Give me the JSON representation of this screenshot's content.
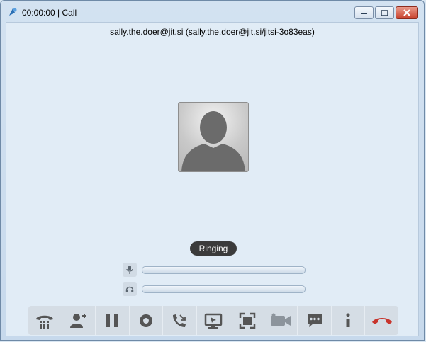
{
  "window": {
    "title": "00:00:00 | Call",
    "icon": "jitsi-logo-icon"
  },
  "call": {
    "peer": "sally.the.doer@jit.si (sally.the.doer@jit.si/jitsi-3o83eas)",
    "status": "Ringing"
  },
  "levels": {
    "mic_icon": "microphone-icon",
    "speaker_icon": "headphones-icon"
  },
  "toolbar": {
    "buttons": [
      "dialpad-icon",
      "add-participant-icon",
      "hold-icon",
      "record-icon",
      "transfer-icon",
      "desktop-share-icon",
      "fullscreen-icon",
      "video-icon",
      "chat-icon",
      "info-icon",
      "hangup-icon"
    ]
  },
  "colors": {
    "hangup": "#c8352d",
    "status_bg": "#3b3b3b"
  }
}
